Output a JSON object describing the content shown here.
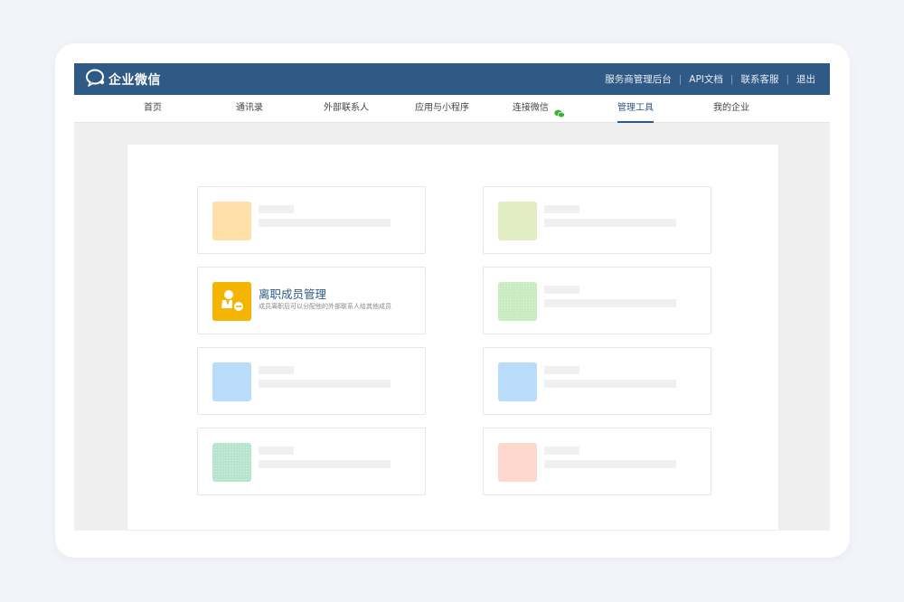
{
  "app": {
    "logo_text": "企业微信",
    "logo_icon": "wecom-chat-icon"
  },
  "top_links": [
    {
      "label": "服务商管理后台"
    },
    {
      "label": "API文档"
    },
    {
      "label": "联系客服"
    },
    {
      "label": "退出"
    }
  ],
  "top_link_separator": "|",
  "nav": {
    "items": [
      {
        "label": "首页"
      },
      {
        "label": "通讯录"
      },
      {
        "label": "外部联系人"
      },
      {
        "label": "应用与小程序"
      },
      {
        "label": "连接微信",
        "icon": "wechat-icon"
      },
      {
        "label": "管理工具",
        "active": true
      },
      {
        "label": "我的企业"
      }
    ]
  },
  "tools": {
    "featured": {
      "title": "离职成员管理",
      "description": "成员离职后可以分配他的外部联系人给其他成员",
      "icon": "user-remove-icon",
      "color": "#f4b400"
    },
    "placeholder_colors": {
      "orange": "#ffe0a8",
      "lime": "#e2edc4",
      "green": "#c8ecc0",
      "blue": "#b9dcfb",
      "teal": "#b6e4cf",
      "salmon": "#fdd8cc"
    }
  },
  "colors": {
    "brand": "#2f5a85",
    "page_bg": "#f2f4f9",
    "window_bg": "#efefef"
  }
}
